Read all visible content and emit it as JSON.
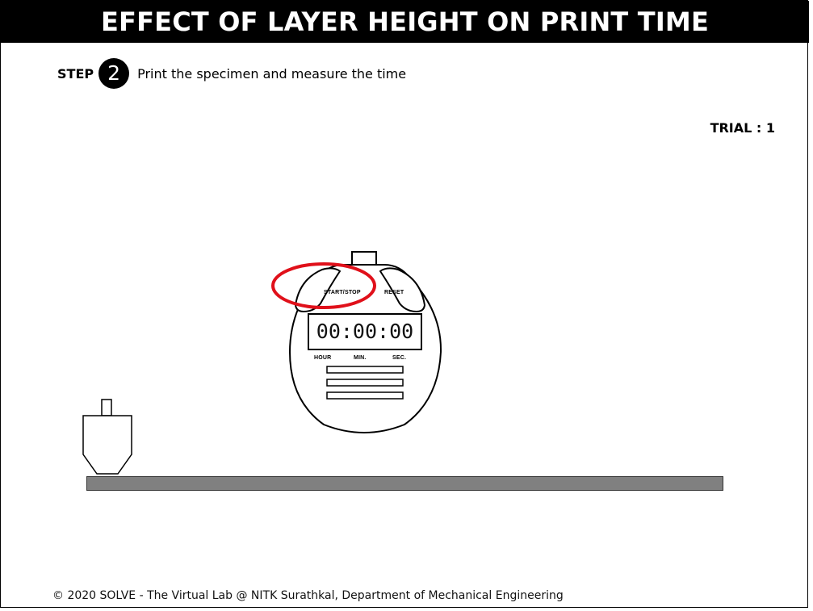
{
  "header": {
    "title": "EFFECT OF LAYER HEIGHT ON PRINT TIME"
  },
  "step": {
    "label": "STEP",
    "number": "2",
    "instruction": "Print the specimen and measure the time"
  },
  "trial": {
    "text": "TRIAL : 1"
  },
  "stopwatch": {
    "start_stop_label": "START/STOP",
    "reset_label": "RESET",
    "display": "00:00:00",
    "hour_label": "HOUR",
    "min_label": "MIN.",
    "sec_label": "SEC.",
    "highlight_color": "#e0101a"
  },
  "colors": {
    "title_bar_bg": "#000000",
    "title_text": "#ffffff",
    "bed": "#808080"
  },
  "footer": {
    "text": "© 2020 SOLVE - The Virtual Lab @ NITK Surathkal, Department of Mechanical Engineering"
  }
}
